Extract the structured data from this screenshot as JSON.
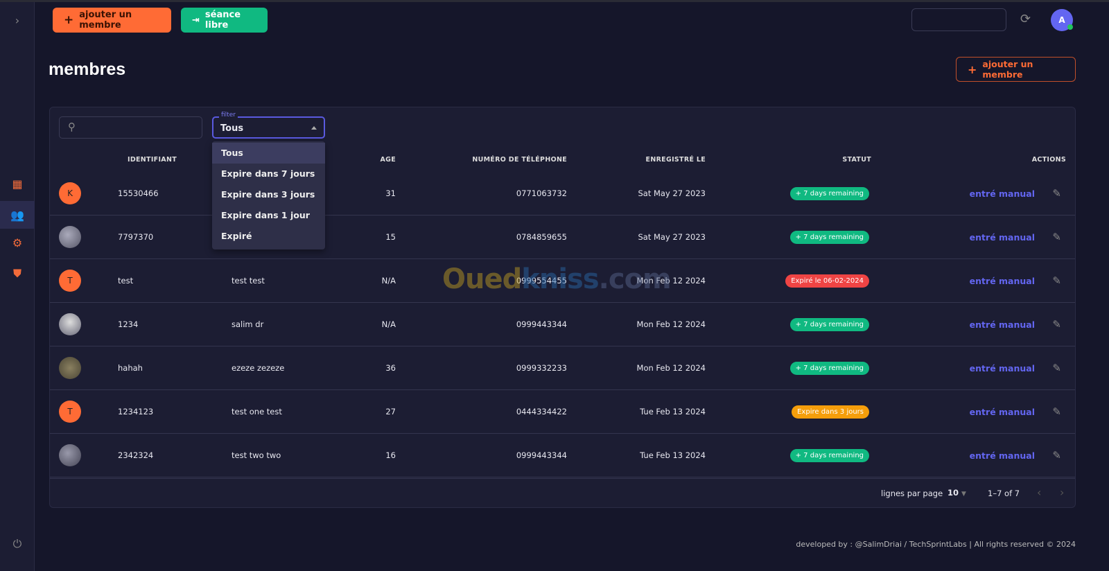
{
  "sidebar": {
    "expand_icon": "chevron-right-icon",
    "items": [
      {
        "icon": "dashboard-icon"
      },
      {
        "icon": "users-icon",
        "active": true
      },
      {
        "icon": "gear-icon"
      },
      {
        "icon": "shield-icon"
      }
    ],
    "power_icon": "power-icon"
  },
  "topbar": {
    "add_member_label": "ajouter un membre",
    "free_session_label": "séance libre",
    "avatar_letter": "A",
    "colors": {
      "orange": "#ff6b35",
      "green": "#10b981"
    }
  },
  "page": {
    "title": "membres",
    "add_member_label": "ajouter un membre"
  },
  "filter": {
    "label": "filter",
    "value": "Tous",
    "options": [
      "Tous",
      "Expire dans 7 jours",
      "Expire dans 3 jours",
      "Expire dans 1 jour",
      "Expiré"
    ]
  },
  "table": {
    "headers": [
      "IDENTIFIANT",
      "",
      "AGE",
      "NUMÉRO DE TÉLÉPHONE",
      "ENREGISTRÉ LE",
      "STATUT",
      "ACTIONS"
    ],
    "rows": [
      {
        "avatar": "K",
        "avatar_type": "letter",
        "id": "15530466",
        "name": "",
        "age": "31",
        "phone": "0771063732",
        "date": "Sat May 27 2023",
        "status": "+ 7 days remaining",
        "status_color": "#10b981",
        "action": "entré manual"
      },
      {
        "avatar": "",
        "avatar_type": "photo",
        "id": "7797370",
        "name": "",
        "age": "15",
        "phone": "0784859655",
        "date": "Sat May 27 2023",
        "status": "+ 7 days remaining",
        "status_color": "#10b981",
        "action": "entré manual"
      },
      {
        "avatar": "T",
        "avatar_type": "letter",
        "id": "test",
        "name": "test test",
        "age": "N/A",
        "phone": "0999554455",
        "date": "Mon Feb 12 2024",
        "status": "Expiré le 06-02-2024",
        "status_color": "#ef4444",
        "action": "entré manual"
      },
      {
        "avatar": "",
        "avatar_type": "photo",
        "id": "1234",
        "name": "salim dr",
        "age": "N/A",
        "phone": "0999443344",
        "date": "Mon Feb 12 2024",
        "status": "+ 7 days remaining",
        "status_color": "#10b981",
        "action": "entré manual"
      },
      {
        "avatar": "",
        "avatar_type": "photo",
        "id": "hahah",
        "name": "ezeze zezeze",
        "age": "36",
        "phone": "0999332233",
        "date": "Mon Feb 12 2024",
        "status": "+ 7 days remaining",
        "status_color": "#10b981",
        "action": "entré manual"
      },
      {
        "avatar": "T",
        "avatar_type": "letter",
        "id": "1234123",
        "name": "test one test",
        "age": "27",
        "phone": "0444334422",
        "date": "Tue Feb 13 2024",
        "status": "Expire dans 3 jours",
        "status_color": "#f59e0b",
        "action": "entré manual"
      },
      {
        "avatar": "",
        "avatar_type": "photo",
        "id": "2342324",
        "name": "test two two",
        "age": "16",
        "phone": "0999443344",
        "date": "Tue Feb 13 2024",
        "status": "+ 7 days remaining",
        "status_color": "#10b981",
        "action": "entré manual"
      }
    ]
  },
  "pagination": {
    "rows_label": "lignes par page",
    "rows_value": "10",
    "range": "1–7 of 7"
  },
  "watermark": "Ouedkniss.com",
  "footer": "developed by : @SalimDriai / TechSprintLabs | All rights reserved © 2024"
}
